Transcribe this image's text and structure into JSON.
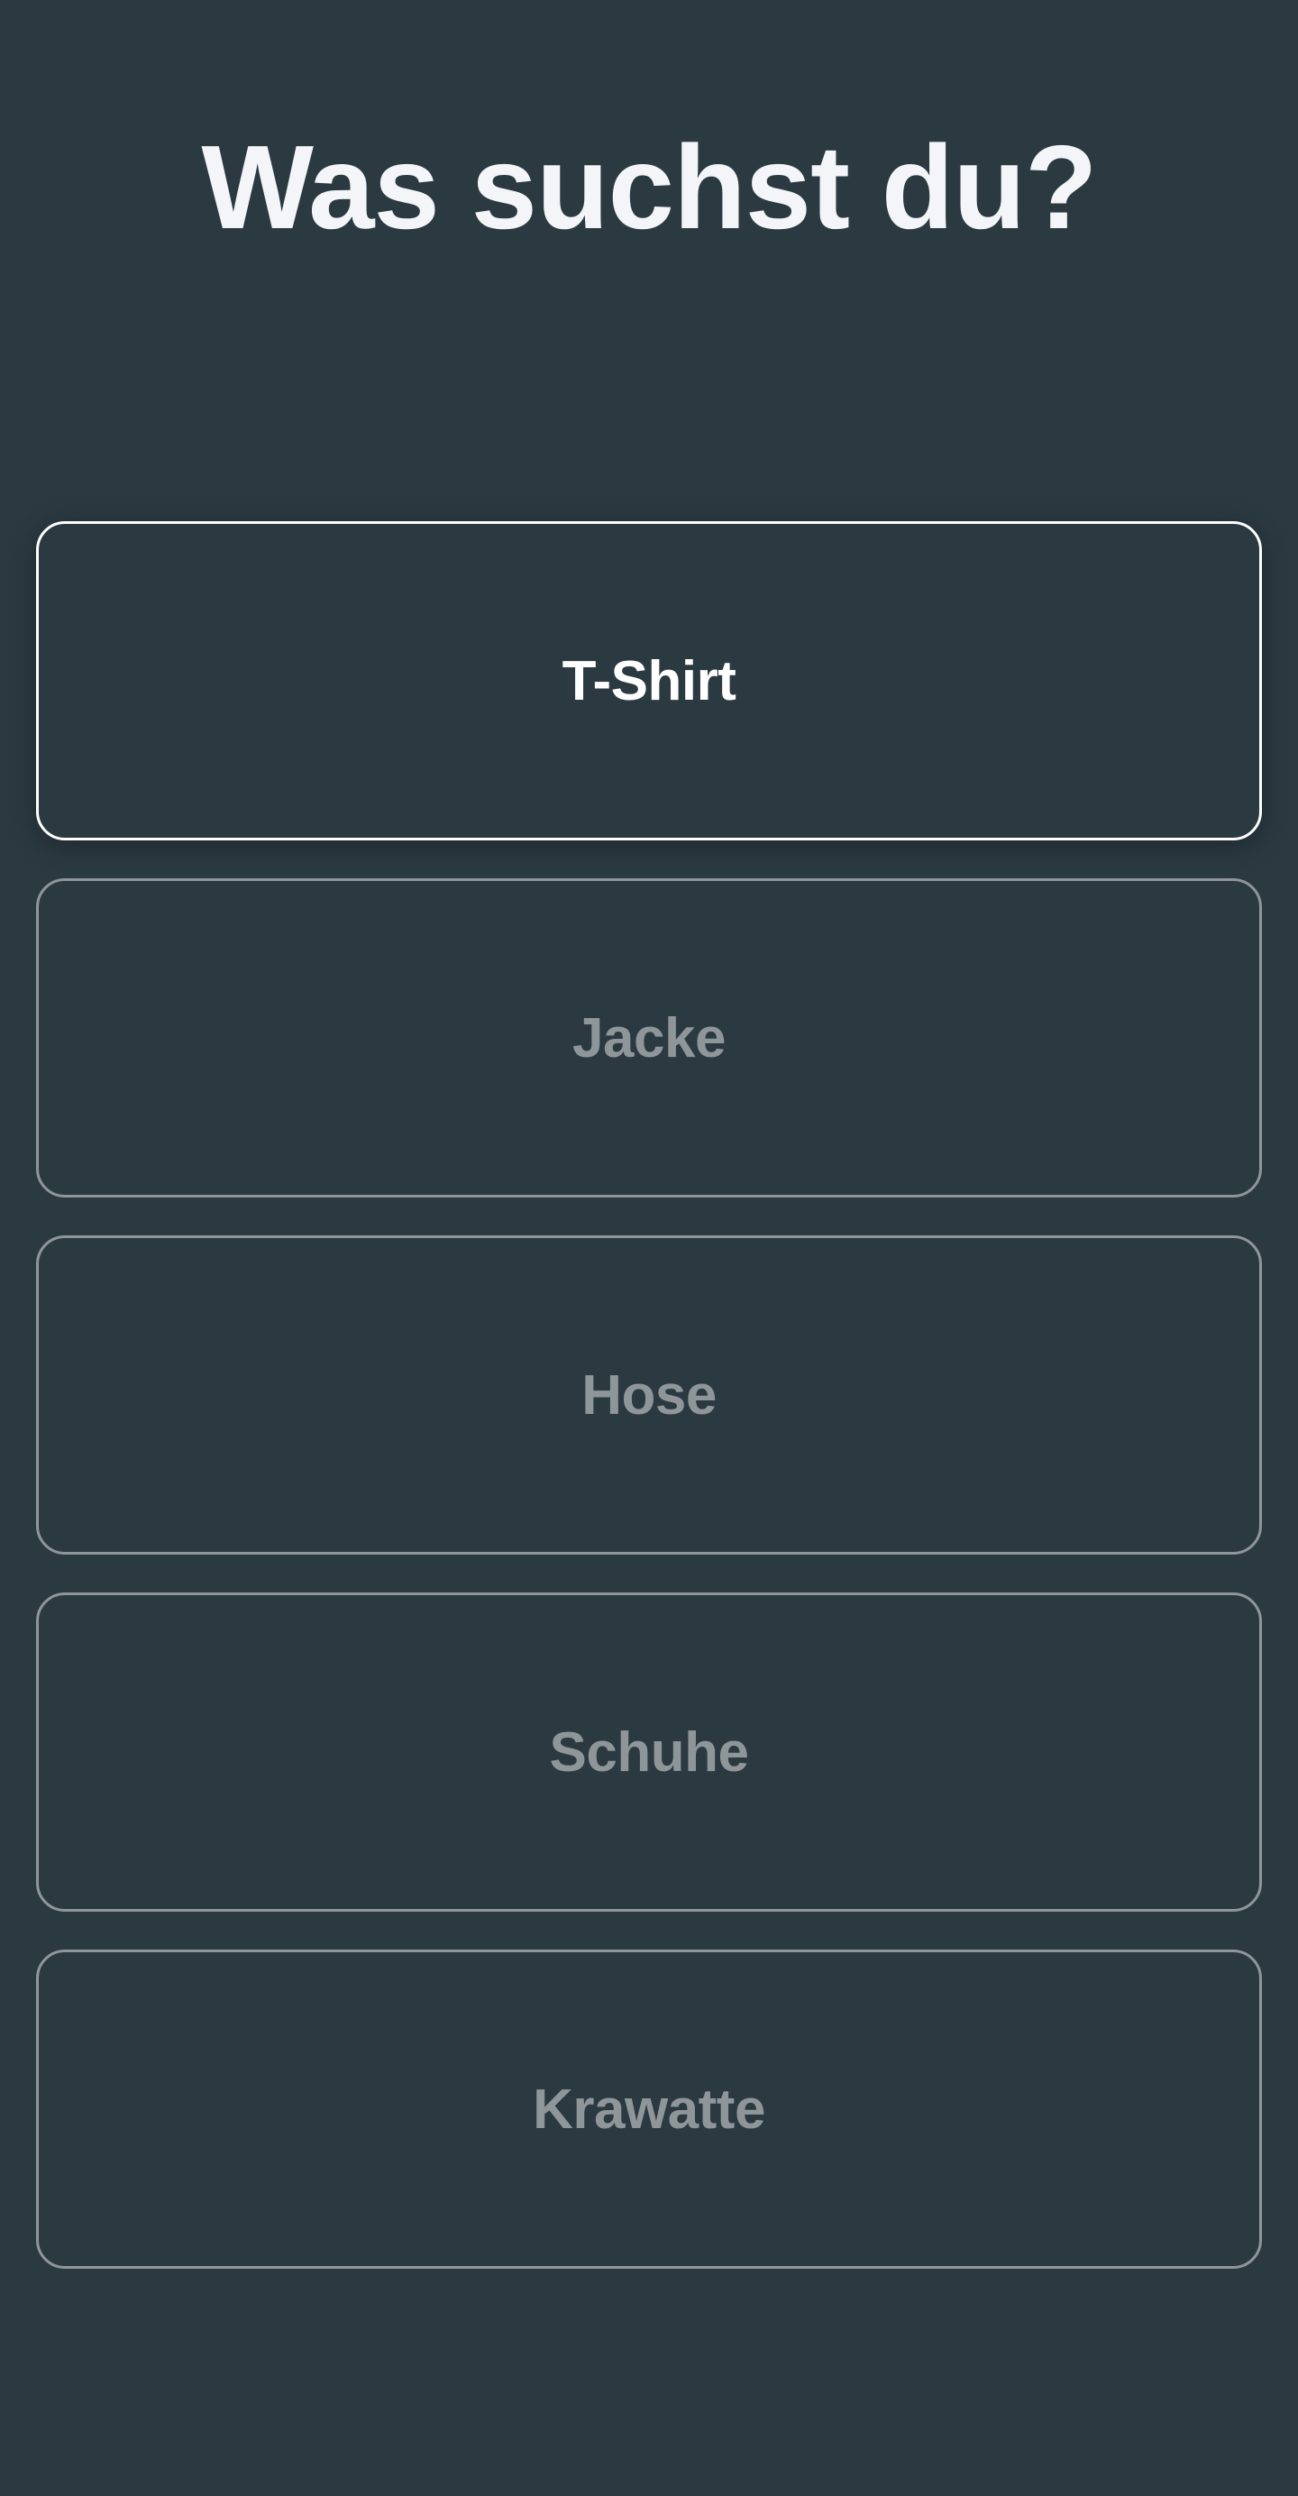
{
  "header": {
    "title": "Was suchst du?"
  },
  "options": [
    {
      "label": "T-Shirt",
      "selected": true
    },
    {
      "label": "Jacke",
      "selected": false
    },
    {
      "label": "Hose",
      "selected": false
    },
    {
      "label": "Schuhe",
      "selected": false
    },
    {
      "label": "Krawatte",
      "selected": false
    }
  ],
  "colors": {
    "background": "#2b3941",
    "title": "#f3f5f8",
    "selected_border": "#ffffff",
    "unselected_border": "#8f969a",
    "unselected_text": "#8f969a"
  }
}
